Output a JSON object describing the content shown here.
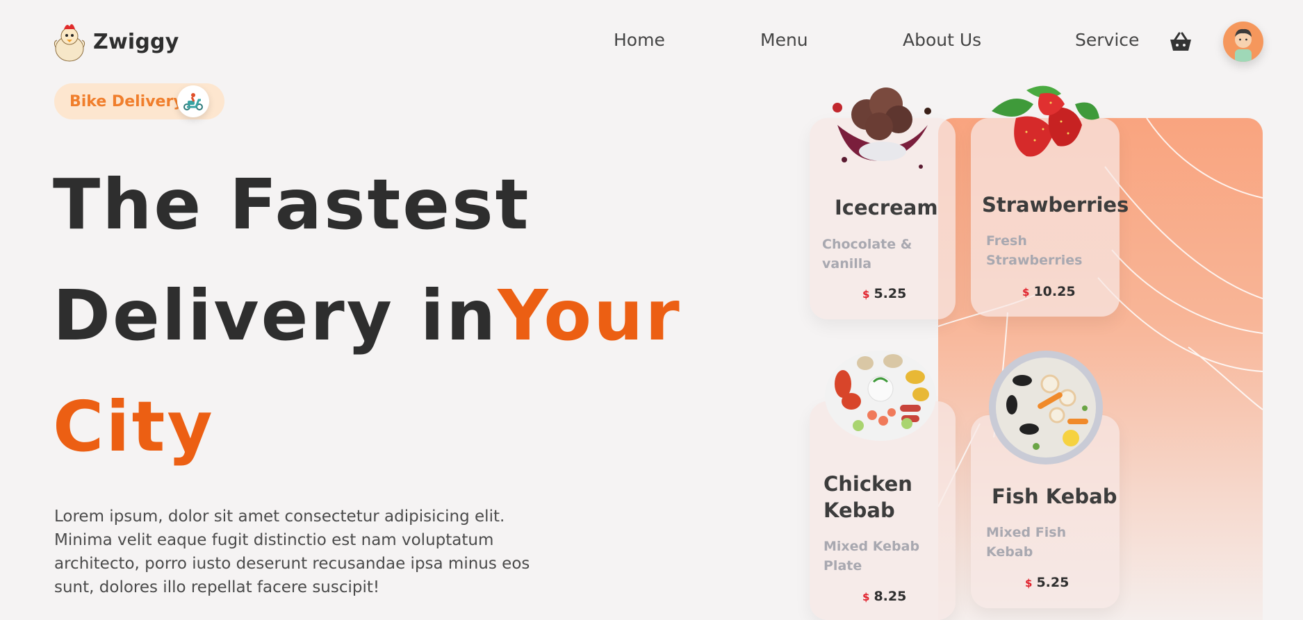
{
  "brand": {
    "name": "Zwiggy",
    "accent": "#ec5f13"
  },
  "nav": {
    "items": [
      "Home",
      "Menu",
      "About Us",
      "Service"
    ],
    "cart_icon": "basket-icon",
    "avatar_icon": "user-avatar-icon"
  },
  "hero": {
    "badge_label": "Bike Delivery",
    "badge_icon": "scooter-icon",
    "title_line1": "The Fastest",
    "title_line2_plain": "Delivery in",
    "title_line2_accent": "Your",
    "title_line3_accent": "City",
    "description": "Lorem ipsum, dolor sit amet consectetur adipisicing elit. Minima velit eaque fugit distinctio est nam voluptatum architecto, porro iusto deserunt recusandae ipsa minus eos sunt, dolores illo repellat facere suscipit!"
  },
  "products": [
    {
      "name": "Icecream",
      "desc": "Chocolate & vanilla",
      "currency": "$",
      "price": "5.25",
      "image": "icecream-image"
    },
    {
      "name": "Strawberries",
      "desc": "Fresh Strawberries",
      "currency": "$",
      "price": "10.25",
      "image": "strawberries-image"
    },
    {
      "name": "Chicken Kebab",
      "desc": "Mixed Kebab Plate",
      "currency": "$",
      "price": "8.25",
      "image": "chicken-kebab-image"
    },
    {
      "name": "Fish Kebab",
      "desc": "Mixed Fish Kebab",
      "currency": "$",
      "price": "5.25",
      "image": "fish-kebab-image"
    }
  ]
}
